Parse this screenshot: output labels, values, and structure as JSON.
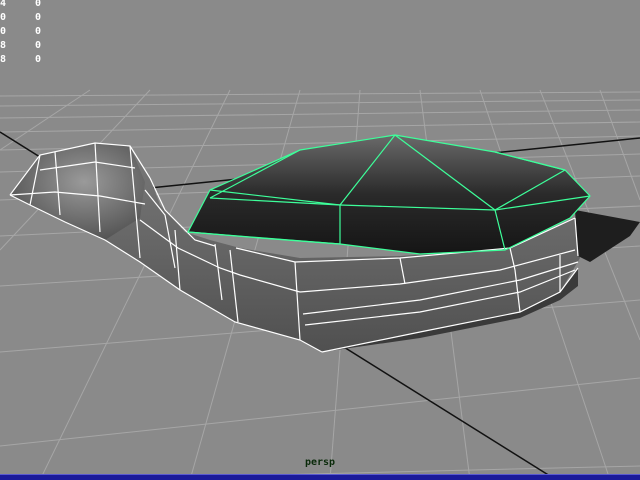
{
  "viewport": {
    "camera": "persp",
    "frame_color": "#1a1a9a",
    "background_color": "#8a8a8a",
    "selection_color": "#3dff9a",
    "wire_color": "#ffffff"
  },
  "hud": {
    "rows": [
      {
        "col_a": "4",
        "col_b": "0"
      },
      {
        "col_a": "0",
        "col_b": "0"
      },
      {
        "col_a": "0",
        "col_b": "0"
      },
      {
        "col_a": "8",
        "col_b": "0"
      },
      {
        "col_a": "8",
        "col_b": "0"
      }
    ]
  }
}
